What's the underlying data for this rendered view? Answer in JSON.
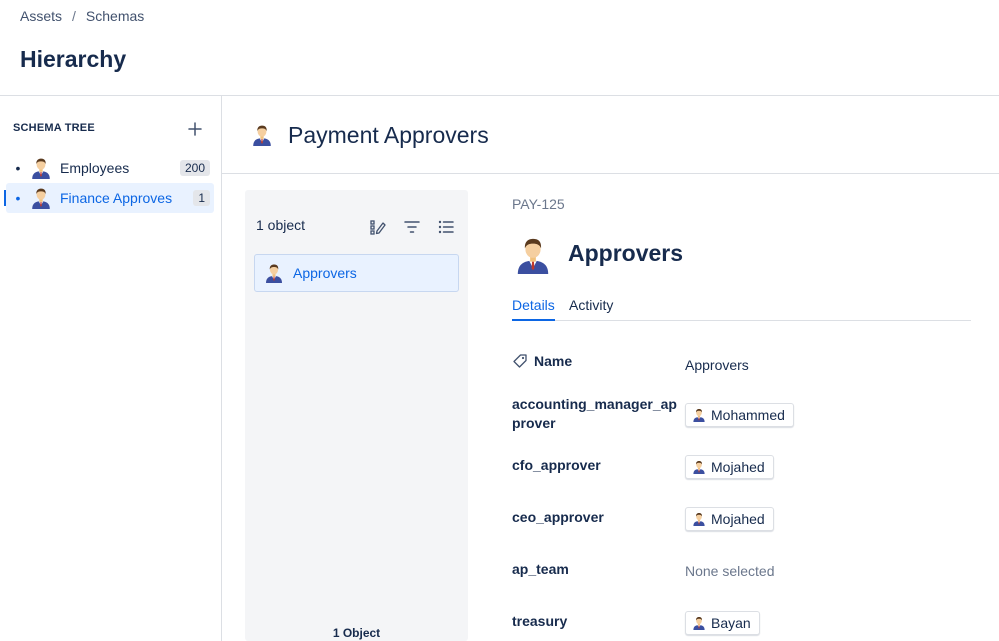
{
  "breadcrumb": {
    "items": [
      "Assets",
      "Schemas"
    ],
    "separator": "/"
  },
  "page": {
    "title": "Hierarchy"
  },
  "sidebar": {
    "title": "SCHEMA TREE",
    "add_icon": "plus-icon",
    "items": [
      {
        "label": "Employees",
        "count": "200",
        "selected": false,
        "icon": "person-icon"
      },
      {
        "label": "Finance Approves",
        "count": "1",
        "selected": true,
        "icon": "person-icon"
      }
    ]
  },
  "schema": {
    "title": "Payment Approvers",
    "icon": "person-icon"
  },
  "list_panel": {
    "count_label": "1 object",
    "icons": [
      "edit-columns-icon",
      "filter-icon",
      "list-view-icon"
    ],
    "items": [
      {
        "label": "Approvers",
        "selected": true
      }
    ],
    "footer": "1 Object"
  },
  "object": {
    "key": "PAY-125",
    "title": "Approvers",
    "tabs": [
      {
        "label": "Details",
        "active": true
      },
      {
        "label": "Activity",
        "active": false
      }
    ],
    "attributes": [
      {
        "name": "Name",
        "value": "Approvers",
        "type": "text"
      },
      {
        "name": "accounting_manager_ap prover",
        "value": "Mohammed",
        "type": "user"
      },
      {
        "name": "cfo_approver",
        "value": "Mojahed",
        "type": "user"
      },
      {
        "name": "ceo_approver",
        "value": "Mojahed",
        "type": "user"
      },
      {
        "name": "ap_team",
        "value": "None selected",
        "type": "empty"
      },
      {
        "name": "treasury",
        "value": "Bayan",
        "type": "user"
      }
    ]
  },
  "colors": {
    "accent": "#0c66e4",
    "selected_bg": "#e9f2ff",
    "panel_bg": "#f4f5f7",
    "text": "#172b4d",
    "muted": "#6b778c"
  }
}
